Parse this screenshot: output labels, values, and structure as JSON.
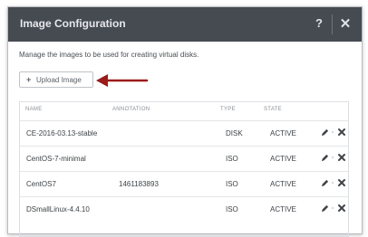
{
  "dialog": {
    "title": "Image Configuration",
    "help_label": "?",
    "close_label": "✕"
  },
  "description": "Manage the images to be used for creating virtual disks.",
  "upload_button": {
    "icon": "plus-icon",
    "label": "Upload Image"
  },
  "annotation_arrow": {
    "color": "#9b1b1b"
  },
  "table": {
    "columns": [
      "NAME",
      "ANNOTATION",
      "TYPE",
      "STATE"
    ],
    "rows": [
      {
        "name": "CE-2016-03.13-stable",
        "annotation": "",
        "type": "DISK",
        "state": "ACTIVE"
      },
      {
        "name": "CentOS-7-minimal",
        "annotation": "",
        "type": "ISO",
        "state": "ACTIVE"
      },
      {
        "name": "CentOS7",
        "annotation": "1461183893",
        "type": "ISO",
        "state": "ACTIVE"
      },
      {
        "name": "DSmallLinux-4.4.10",
        "annotation": "",
        "type": "ISO",
        "state": "ACTIVE"
      }
    ],
    "row_actions": [
      "pencil-icon",
      "delete-x-icon"
    ]
  },
  "colors": {
    "header_bg": "#464b52",
    "header_text": "#e6e8eb",
    "body_text": "#3d4247",
    "muted_text": "#8a8f95"
  }
}
